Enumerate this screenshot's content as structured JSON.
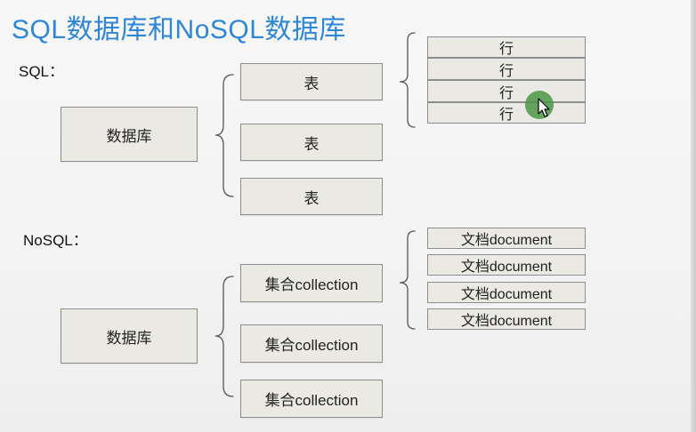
{
  "title": "SQL数据库和NoSQL数据库",
  "sql": {
    "label": "SQL：",
    "database": "数据库",
    "tables": [
      "表",
      "表",
      "表"
    ],
    "rows": [
      "行",
      "行",
      "行",
      "行"
    ]
  },
  "nosql": {
    "label": "NoSQL：",
    "database": "数据库",
    "collections": [
      "集合collection",
      "集合collection",
      "集合collection"
    ],
    "documents": [
      "文档document",
      "文档document",
      "文档document",
      "文档document"
    ]
  },
  "colors": {
    "title": "#2e86d6",
    "box_fill": "#ebe9e3",
    "box_border": "#8d8d8d",
    "cursor_highlight": "#4c9646"
  },
  "icons": [
    "mouse-pointer-icon"
  ]
}
